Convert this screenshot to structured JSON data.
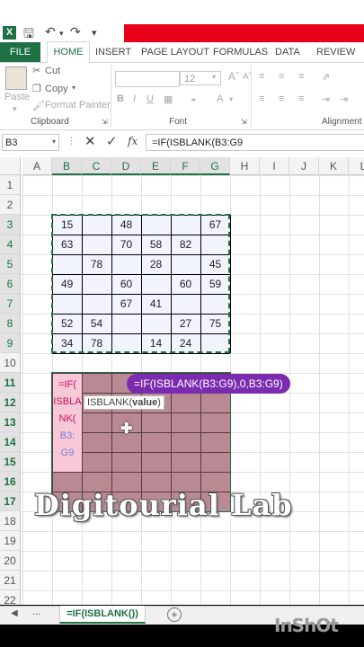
{
  "window": {
    "app_icon": "X"
  },
  "tabs": [
    "FILE",
    "HOME",
    "INSERT",
    "PAGE LAYOUT",
    "FORMULAS",
    "DATA",
    "REVIEW"
  ],
  "ribbon": {
    "paste": "Paste",
    "cut": "Cut",
    "copy": "Copy",
    "format_painter": "Format Painter",
    "clipboard": "Clipboard",
    "font_size": "12",
    "font": "Font",
    "alignment": "Alignment"
  },
  "formula_bar": {
    "name_box": "B3",
    "fx": "fx",
    "formula": "=IF(ISBLANK(B3:G9"
  },
  "columns": [
    "A",
    "B",
    "C",
    "D",
    "E",
    "F",
    "G",
    "H",
    "I",
    "J",
    "K",
    "L"
  ],
  "rows": [
    "1",
    "2",
    "3",
    "4",
    "5",
    "6",
    "7",
    "8",
    "9",
    "10",
    "11",
    "12",
    "13",
    "14",
    "15",
    "16",
    "17",
    "18",
    "19",
    "20",
    "21",
    "22"
  ],
  "data": [
    [
      "15",
      "",
      "48",
      "",
      "",
      "67"
    ],
    [
      "63",
      "",
      "70",
      "58",
      "82",
      ""
    ],
    [
      "",
      "78",
      "",
      "28",
      "",
      "45"
    ],
    [
      "49",
      "",
      "60",
      "",
      "60",
      "59"
    ],
    [
      "",
      "",
      "67",
      "41",
      "",
      ""
    ],
    [
      "52",
      "54",
      "",
      "",
      "27",
      "75"
    ],
    [
      "34",
      "78",
      "",
      "14",
      "24",
      ""
    ]
  ],
  "edit_cell": [
    "=IF(",
    "ISBLA",
    "NK(",
    "B3:",
    "G9"
  ],
  "tooltip": {
    "func": "ISBLANK(",
    "arg": "value",
    "close": ")"
  },
  "formula_bubble": "=IF(ISBLANK(B3:G9),0,B3:G9)",
  "watermark": "Digitourial Lab",
  "sheet_tab": "=IF(ISBLANK())",
  "bottom_watermark": "InShOt",
  "colors": {
    "excel_green": "#1e7145",
    "selection": "#b98a93",
    "edit_pink": "#f9c8d8",
    "bubble": "#7b2bb0",
    "red_band": "#e8001a"
  }
}
